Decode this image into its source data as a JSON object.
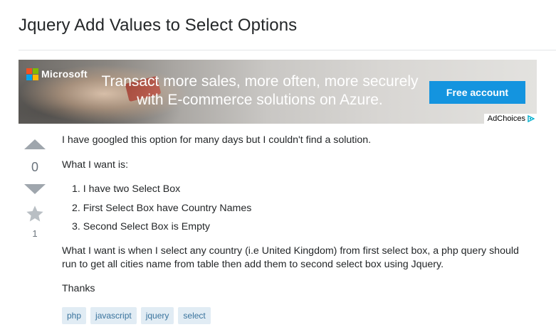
{
  "question": {
    "title": "Jquery Add Values to Select Options"
  },
  "ad": {
    "brand": "Microsoft",
    "headline_line1": "Transact more sales, more often, more securely",
    "headline_line2": "with E-commerce solutions on Azure.",
    "cta": "Free account",
    "adchoices": "AdChoices",
    "colors": {
      "cta_bg": "#1494df",
      "ms_red": "#f25022",
      "ms_green": "#7fba00",
      "ms_blue": "#00a4ef",
      "ms_yellow": "#ffb900"
    }
  },
  "votes": {
    "score": "0",
    "favorites": "1"
  },
  "body": {
    "p1": "I have googled this option for many days but I couldn't find a solution.",
    "p2": "What I want is:",
    "list": [
      "1. I have two Select Box",
      "2. First Select Box have Country Names",
      "3. Second Select Box is Empty"
    ],
    "p3": "What I want is when I select any country (i.e United Kingdom) from first select box, a php query should run to get all cities name from table then add them to second select box using Jquery.",
    "p4": "Thanks"
  },
  "tags": [
    "php",
    "javascript",
    "jquery",
    "select"
  ],
  "colors": {
    "tag_bg": "#e1ecf4",
    "tag_text": "#39739d",
    "vote_arrow": "#9fa6ad"
  }
}
